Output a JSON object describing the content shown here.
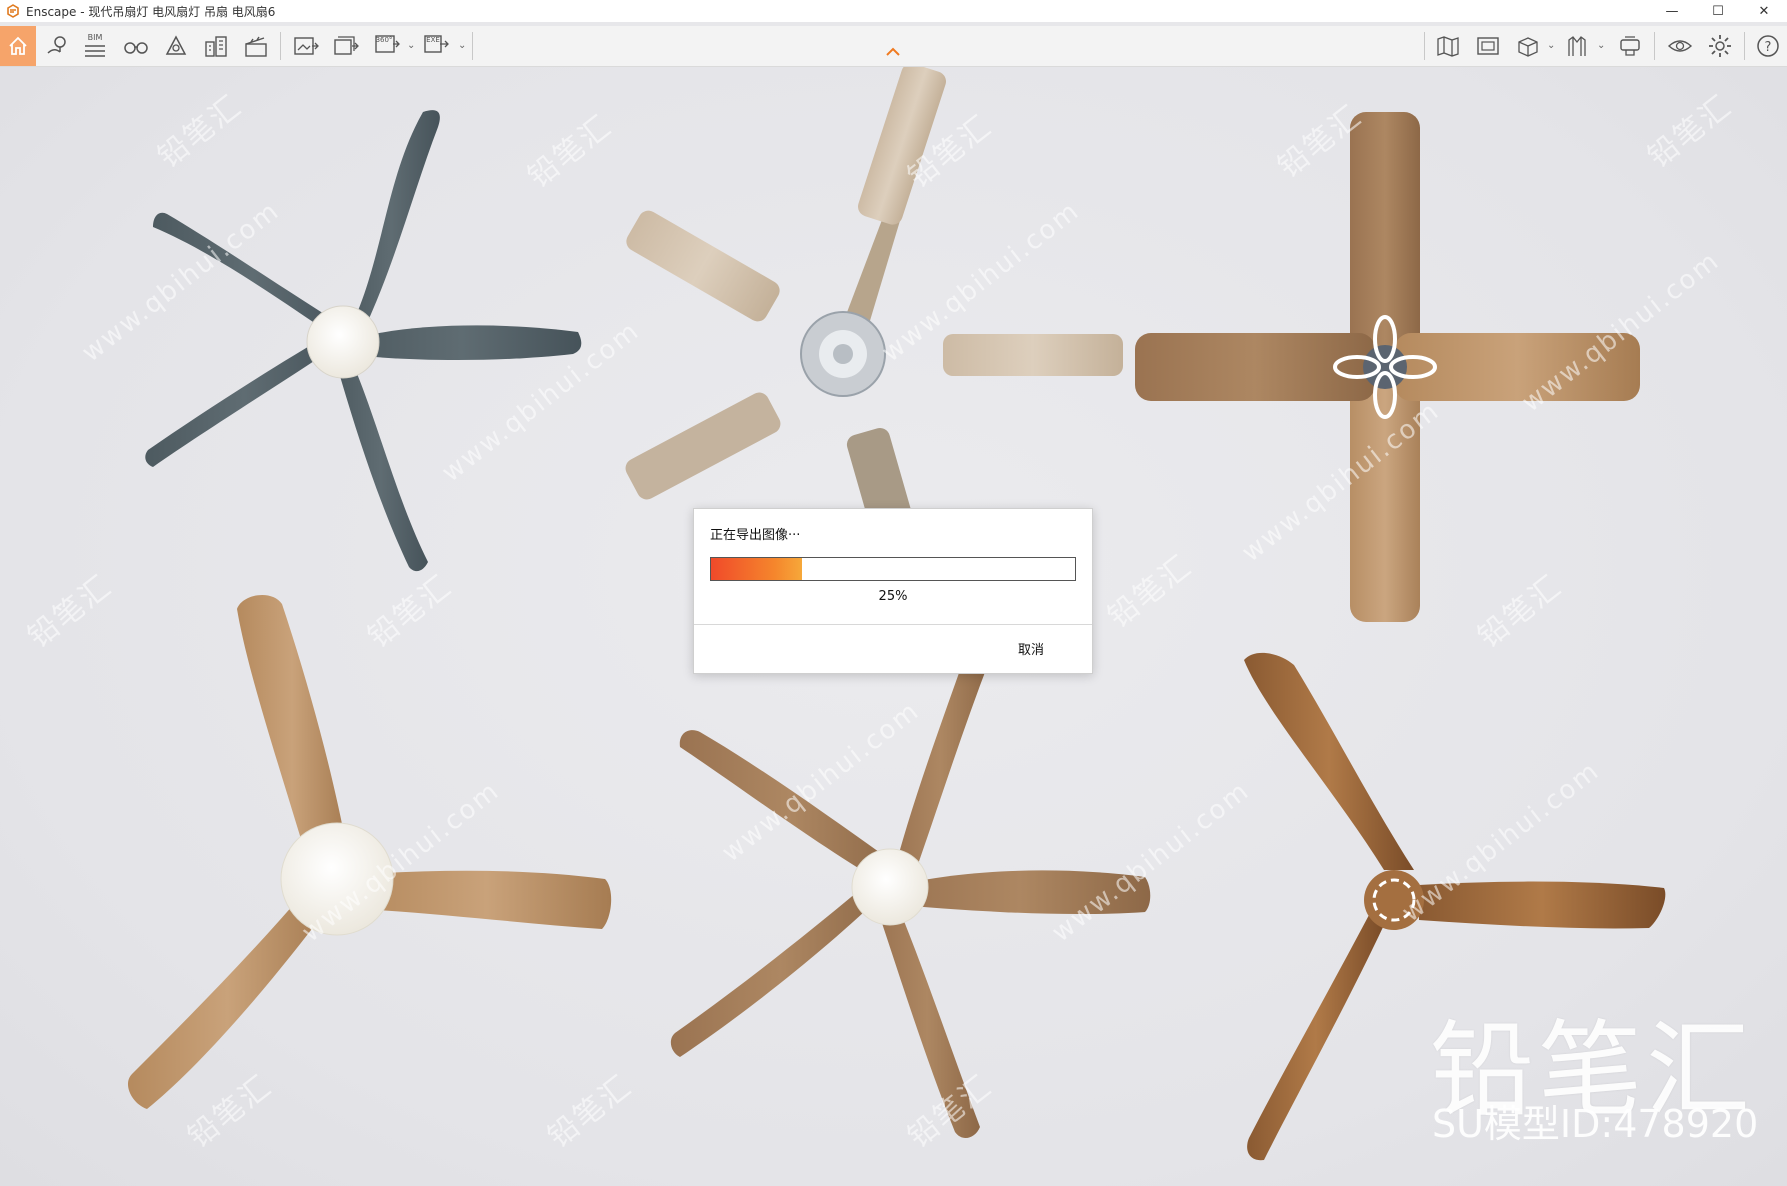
{
  "window": {
    "title": "Enscape - 现代吊扇灯 电风扇灯 吊扇 电风扇6",
    "minimize_glyph": "—",
    "maximize_glyph": "☐",
    "close_glyph": "✕"
  },
  "toolbar": {
    "left_icons": [
      "home-icon",
      "map-pin-icon",
      "bim-icon",
      "binoculars-icon",
      "atmosphere-icon",
      "buildings-icon",
      "clapper-icon",
      "export-image-icon",
      "batch-export-icon",
      "panorama-export-icon",
      "exe-export-icon"
    ],
    "bim_label": "BIM",
    "panorama_label": "360°",
    "exe_label": "EXE",
    "right_icons": [
      "minimap-icon",
      "asset-library-icon",
      "view-cube-icon",
      "materials-icon",
      "sync-icon",
      "visual-settings-icon",
      "settings-icon",
      "help-icon"
    ],
    "collapse_glyph": "^"
  },
  "dialog": {
    "title": "正在导出图像···",
    "progress": 0.25,
    "percent_text": "25%",
    "cancel_label": "取消",
    "accent_color": "#f5862c"
  },
  "viewport": {
    "watermark_text": "www.qbihui.com",
    "watermark_cn": "铅笔汇",
    "brand": "铅笔汇",
    "model_id": "SU模型ID:478920"
  }
}
